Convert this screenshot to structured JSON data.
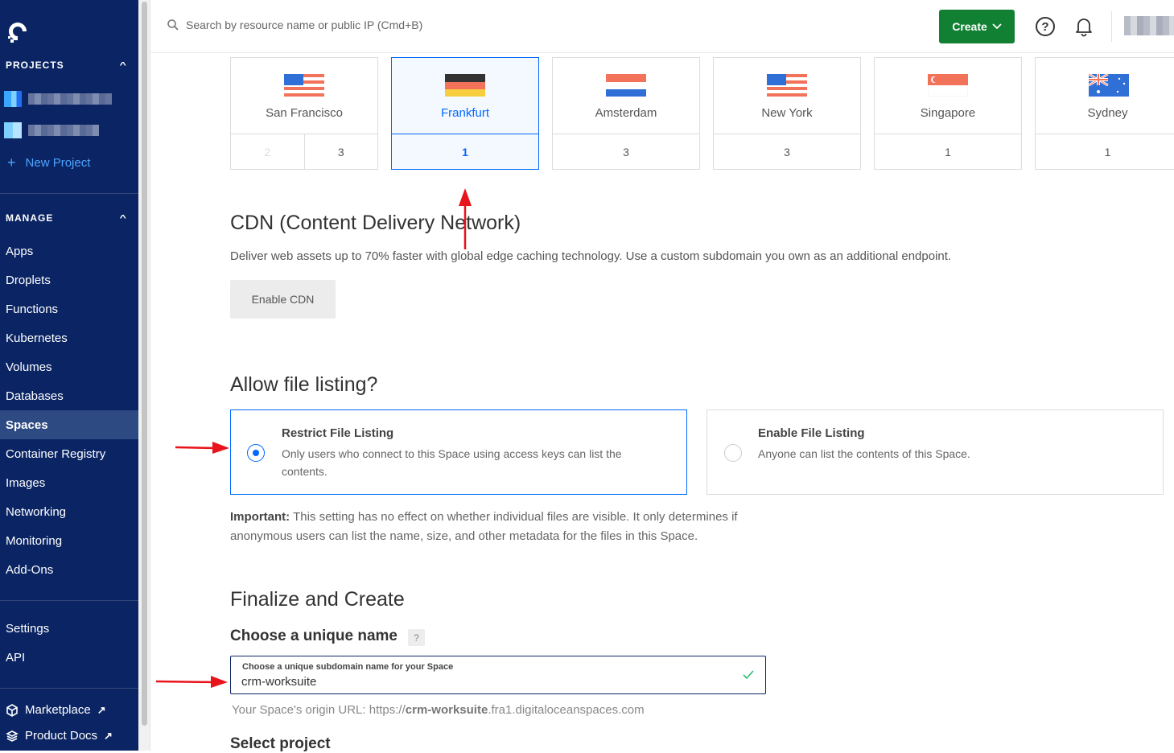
{
  "sidebar": {
    "projects_header": "PROJECTS",
    "new_project": "New Project",
    "manage_header": "MANAGE",
    "items": [
      "Apps",
      "Droplets",
      "Functions",
      "Kubernetes",
      "Volumes",
      "Databases",
      "Spaces",
      "Container Registry",
      "Images",
      "Networking",
      "Monitoring",
      "Add-Ons"
    ],
    "active_item": "Spaces",
    "settings": "Settings",
    "api": "API",
    "marketplace": "Marketplace",
    "product_docs": "Product Docs"
  },
  "topbar": {
    "search_placeholder": "Search by resource name or public IP (Cmd+B)",
    "create_label": "Create",
    "help_symbol": "?"
  },
  "regions": [
    {
      "name": "San Francisco",
      "flag": "us-flag-icon",
      "datacenters": [
        "2",
        "3"
      ],
      "selected": false
    },
    {
      "name": "Frankfurt",
      "flag": "de-flag-icon",
      "datacenters": [
        "1"
      ],
      "selected": true
    },
    {
      "name": "Amsterdam",
      "flag": "nl-flag-icon",
      "datacenters": [
        "3"
      ],
      "selected": false
    },
    {
      "name": "New York",
      "flag": "us-flag-icon",
      "datacenters": [
        "3"
      ],
      "selected": false
    },
    {
      "name": "Singapore",
      "flag": "sg-flag-icon",
      "datacenters": [
        "1"
      ],
      "selected": false
    },
    {
      "name": "Sydney",
      "flag": "au-flag-icon",
      "datacenters": [
        "1"
      ],
      "selected": false
    }
  ],
  "cdn": {
    "title": "CDN (Content Delivery Network)",
    "description": "Deliver web assets up to 70% faster with global edge caching technology. Use a custom subdomain you own as an additional endpoint.",
    "button": "Enable CDN"
  },
  "file_listing": {
    "title": "Allow file listing?",
    "restrict_title": "Restrict File Listing",
    "restrict_desc": "Only users who connect to this Space using access keys can list the contents.",
    "enable_title": "Enable File Listing",
    "enable_desc": "Anyone can list the contents of this Space.",
    "important_label": "Important:",
    "important_text": " This setting has no effect on whether individual files are visible. It only determines if anonymous users can list the name, size, and other metadata for the files in this Space."
  },
  "finalize": {
    "title": "Finalize and Create",
    "name_heading": "Choose a unique name",
    "help_badge": "?",
    "input_label": "Choose a unique subdomain name for your Space",
    "input_value": "crm-worksuite",
    "origin_prefix": "Your Space's origin URL: https://",
    "origin_name": "crm-worksuite",
    "origin_suffix": ".fra1.digitaloceanspaces.com",
    "select_project": "Select project"
  },
  "colors": {
    "sidebar": "#0b2564",
    "accent": "#0069ff",
    "create": "#118033",
    "annotation_arrow": "#e8131b"
  }
}
